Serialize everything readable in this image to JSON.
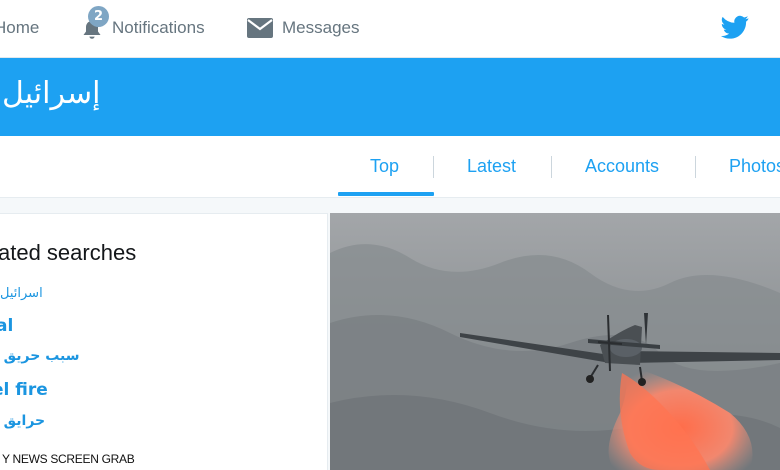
{
  "nav": {
    "home_label": "Home",
    "notifications_label": "Notifications",
    "notifications_count": "2",
    "messages_label": "Messages"
  },
  "search": {
    "title": "إسرائيل"
  },
  "tabs": [
    {
      "label": "Top",
      "active": true
    },
    {
      "label": "Latest"
    },
    {
      "label": "Accounts"
    },
    {
      "label": "Photos"
    }
  ],
  "related": {
    "title": "ated searches",
    "items": [
      "اسرائيل",
      "al",
      "سبب حريق ا",
      "el fire",
      "حرايق ا"
    ]
  },
  "watermark": "Y NEWS SCREEN GRAB",
  "colors": {
    "brand_blue": "#1da1f2",
    "link_blue": "#1b95e0",
    "nav_gray": "#66757f"
  },
  "icons": [
    "bell-icon",
    "envelope-icon",
    "twitter-bird-icon"
  ]
}
